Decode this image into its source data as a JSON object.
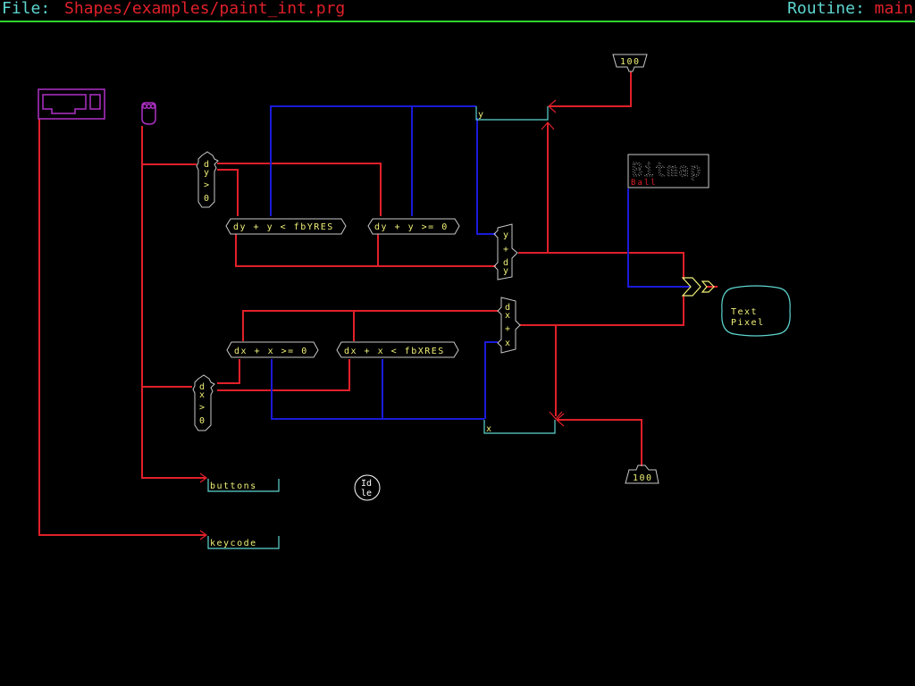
{
  "header": {
    "file_label": "File:",
    "file_path": "Shapes/examples/paint_int.prg",
    "routine_label": "Routine:",
    "routine_name": "main"
  },
  "colors": {
    "background": "#000000",
    "header_rule": "#2fd42f",
    "label_cyan": "#5ed6d0",
    "value_red": "#e0202a",
    "wire_red": "#e0202a",
    "wire_blue": "#1a1ad8",
    "node_text": "#f0f078",
    "node_outline": "#c8c8c8",
    "device_magenta": "#b030c8"
  },
  "diagram": {
    "devices": {
      "keyboard": {
        "name": "keyboard-icon"
      },
      "mouse": {
        "name": "mouse-icon"
      }
    },
    "conditions": {
      "dy_gt_0": [
        "d",
        "y",
        ">",
        "0"
      ],
      "dx_gt_0": [
        "d",
        "x",
        ">",
        "0"
      ]
    },
    "expressions": {
      "dy_y_lt_fbyres": "dy + y < fbYRES",
      "dy_y_ge_0": "dy + y >= 0",
      "dx_x_ge_0": "dx + x >= 0",
      "dx_x_lt_fbxres": "dx + x < fbXRES"
    },
    "adders": {
      "y_plus_dy": [
        "y",
        "+",
        "d",
        "y"
      ],
      "dx_plus_x": [
        "d",
        "x",
        "+",
        "x"
      ]
    },
    "variables": {
      "y": "y",
      "x": "x",
      "buttons": "buttons",
      "keycode": "keycode"
    },
    "constants": {
      "top": "100",
      "bottom": "100"
    },
    "bitmap": {
      "title": "Bitmap",
      "name": "Ball"
    },
    "output": {
      "line1": "Text",
      "line2": "Pixel"
    },
    "idle": {
      "line1": "Id",
      "line2": "le"
    }
  }
}
